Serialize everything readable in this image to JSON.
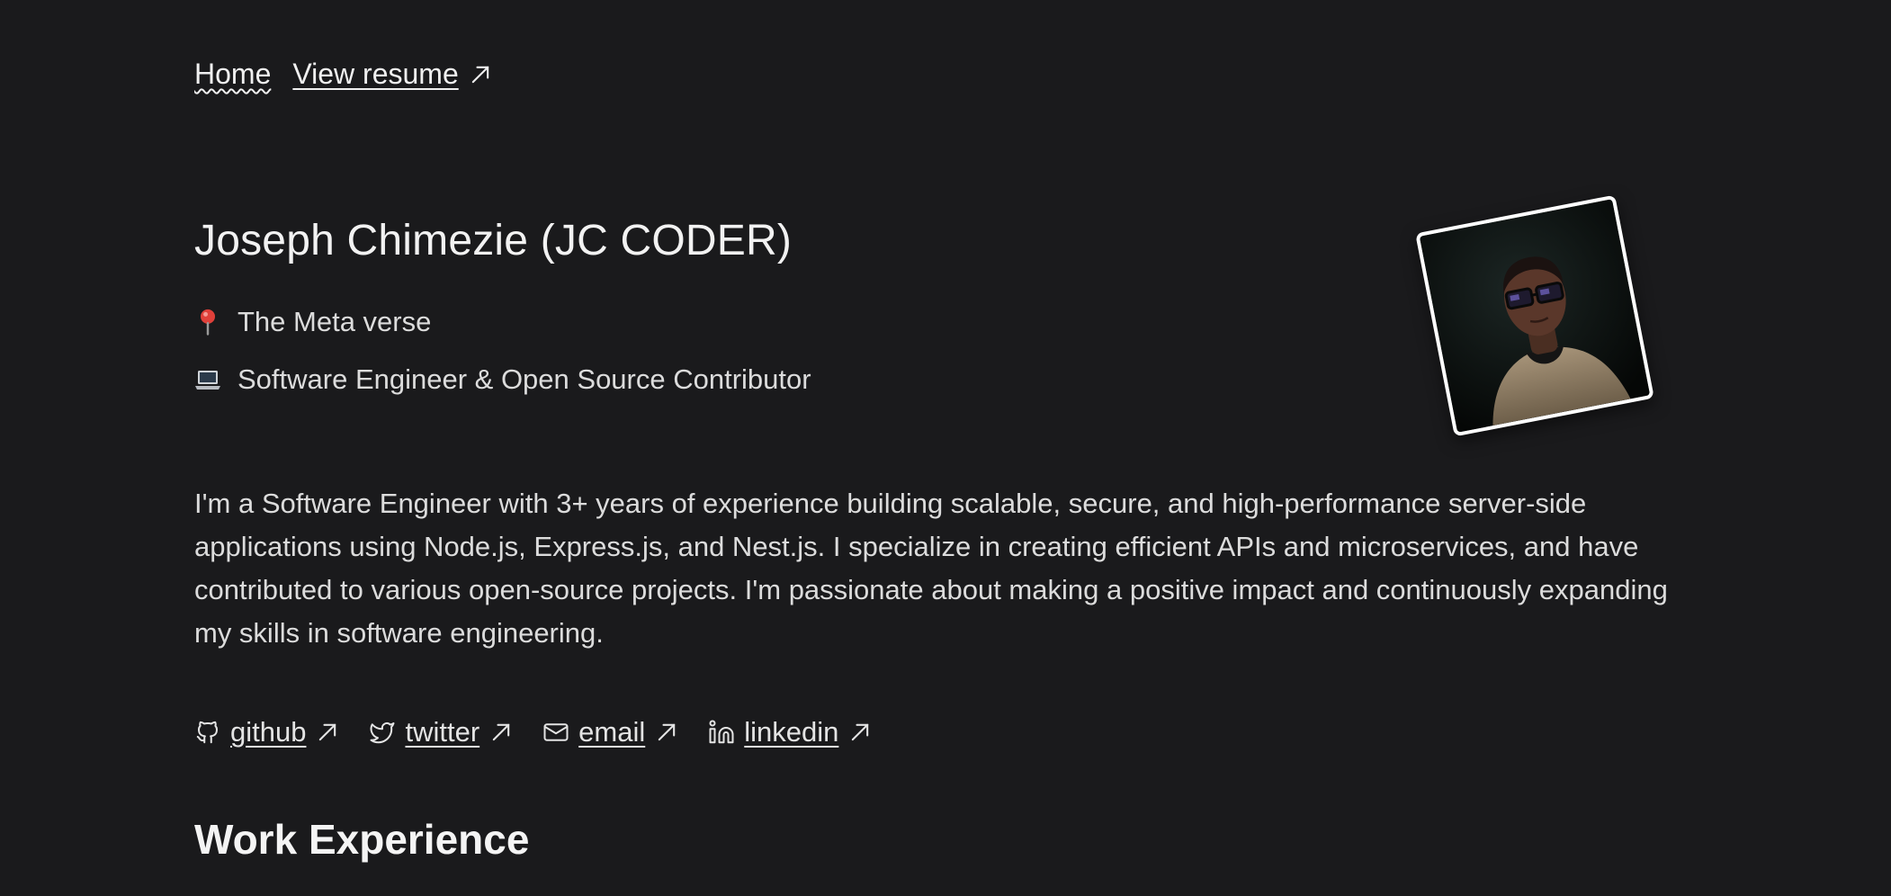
{
  "nav": {
    "home_label": "Home",
    "resume_label": "View resume"
  },
  "profile": {
    "name": "Joseph Chimezie (JC CODER)",
    "location": "The Meta verse",
    "location_icon": "pin-icon",
    "role": "Software Engineer & Open Source Contributor",
    "role_icon": "laptop-icon"
  },
  "bio": "I'm a Software Engineer with 3+ years of experience building scalable, secure, and high-performance server-side applications using Node.js, Express.js, and Nest.js. I specialize in creating efficient APIs and microservices, and have contributed to various open-source projects. I'm passionate about making a positive impact and continuously expanding my skills in software engineering.",
  "socials": [
    {
      "label": "github",
      "icon": "github-icon"
    },
    {
      "label": "twitter",
      "icon": "twitter-icon"
    },
    {
      "label": "email",
      "icon": "mail-icon"
    },
    {
      "label": "linkedin",
      "icon": "linkedin-icon"
    }
  ],
  "sections": {
    "work_experience_title": "Work Experience"
  },
  "colors": {
    "background": "#1a1a1c",
    "text": "#e4e4e4",
    "heading": "#f4f4f4"
  }
}
